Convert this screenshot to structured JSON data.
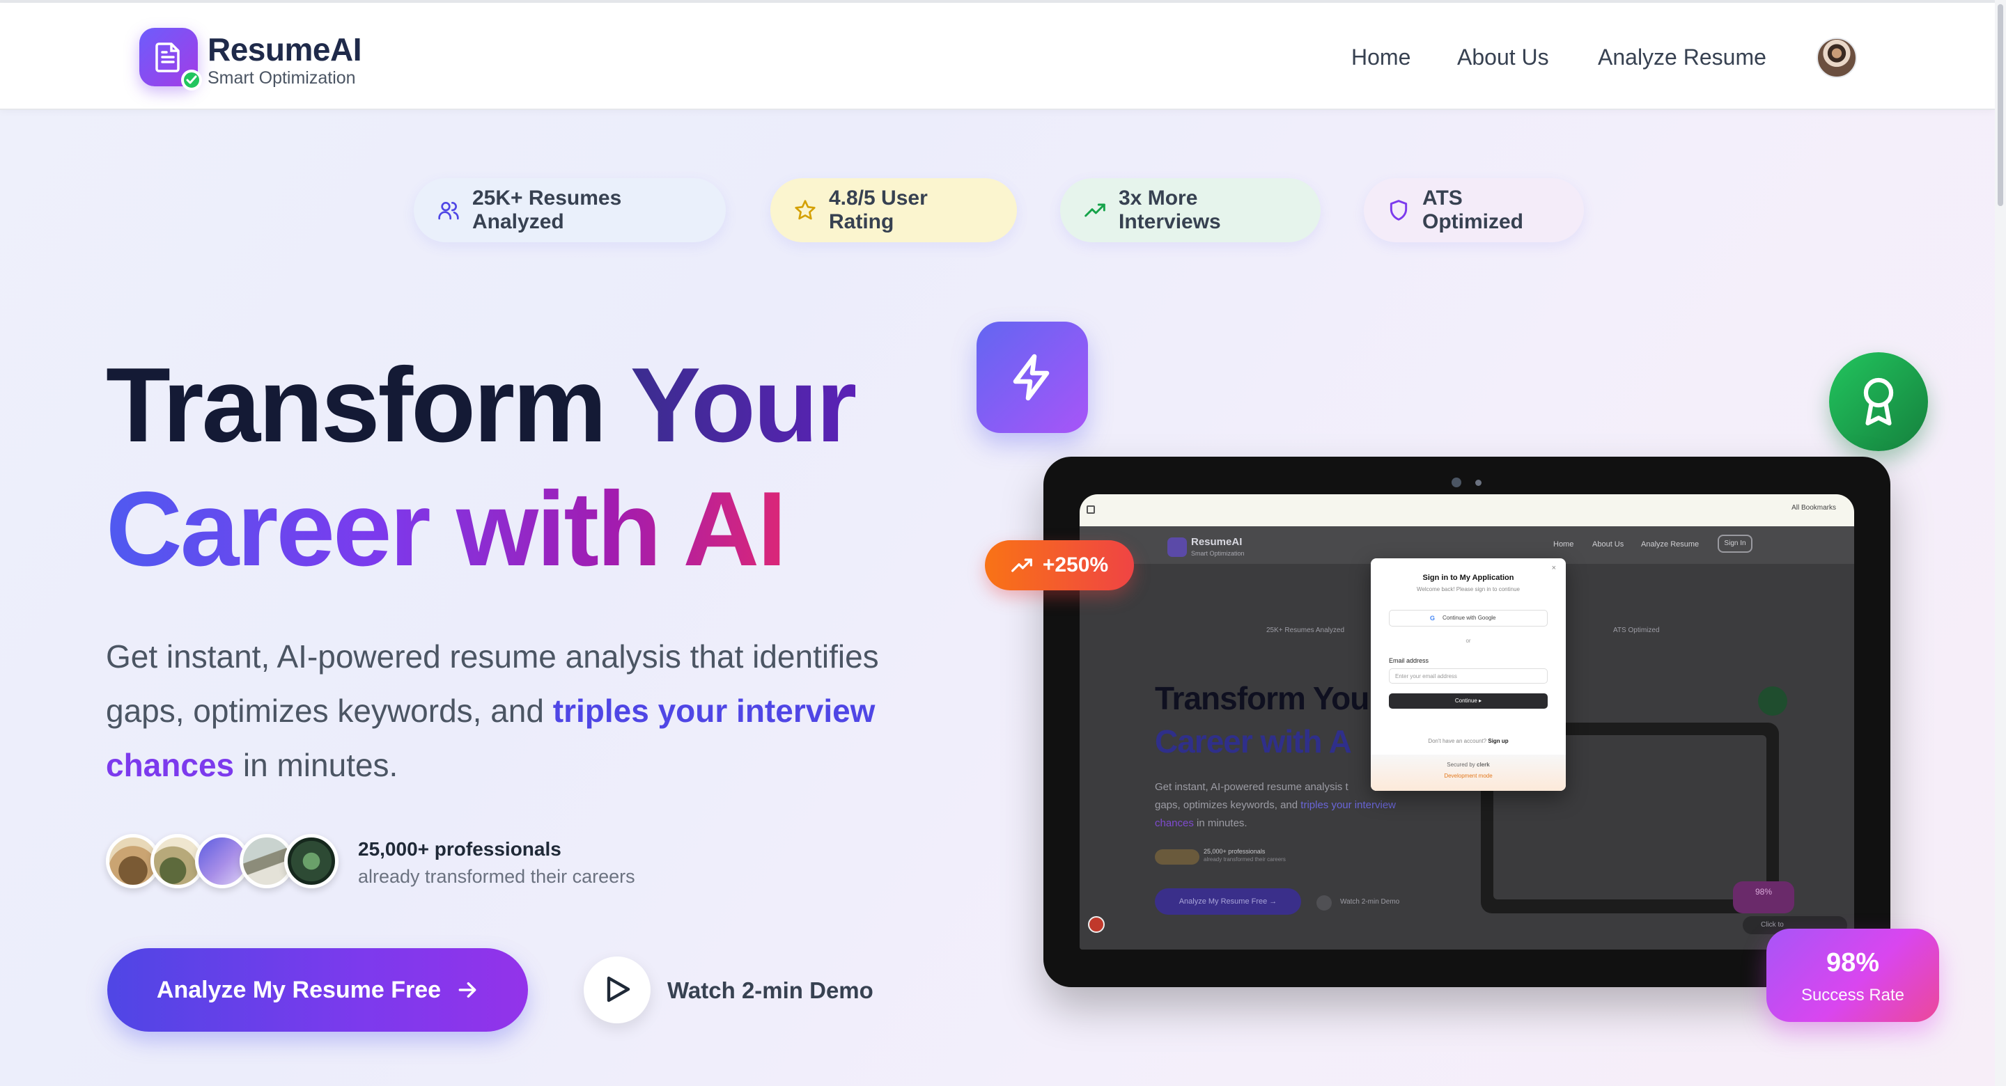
{
  "app": {
    "brand": "ResumeAI",
    "tagline": "Smart Optimization"
  },
  "nav": {
    "items": [
      "Home",
      "About Us",
      "Analyze Resume"
    ]
  },
  "pills": [
    {
      "label": "25K+ Resumes Analyzed",
      "icon": "users-icon",
      "bg": "#eaf0fb",
      "color": "#4f46e5"
    },
    {
      "label": "4.8/5 User Rating",
      "icon": "star-icon",
      "bg": "#fbf5cf",
      "color": "#d4a106"
    },
    {
      "label": "3x More Interviews",
      "icon": "trending-up-icon",
      "bg": "#e6f4ec",
      "color": "#16a34a"
    },
    {
      "label": "ATS Optimized",
      "icon": "shield-icon",
      "bg": "#f4ecf9",
      "color": "#7c3aed"
    }
  ],
  "hero": {
    "line1_a": "Transform ",
    "line1_b": "Your",
    "line2": "Career with AI",
    "desc_1": "Get instant, AI-powered resume analysis that identifies gaps, optimizes keywords, and ",
    "desc_hl_1": "triples your interview",
    "desc_hl_2": "chances",
    "desc_2": " in minutes."
  },
  "social": {
    "count": "25,000+ professionals",
    "sub": "already transformed their careers"
  },
  "cta": {
    "primary": "Analyze My Resume Free",
    "secondary": "Watch 2-min Demo"
  },
  "badges": {
    "growth": "+250%",
    "success_value": "98%",
    "success_label": "Success Rate"
  },
  "preview": {
    "bookmarks": "All Bookmarks",
    "brand": "ResumeAI",
    "brand_sub": "Smart Optimization",
    "nav": [
      "Home",
      "About Us",
      "Analyze Resume"
    ],
    "sign_in_btn": "Sign In",
    "pill_1": "25K+ Resumes Analyzed",
    "pill_4": "ATS Optimized",
    "headline_1": "Transform You",
    "headline_2": "Career with A",
    "desc_1": "Get instant, AI-powered resume analysis t",
    "desc_2": "gaps, optimizes keywords, and ",
    "desc_2_hl": "triples your interview",
    "desc_3": "chances",
    "desc_3_rest": " in minutes.",
    "social_1": "25,000+ professionals",
    "social_2": "already transformed their careers",
    "cta": "Analyze My Resume Free →",
    "demo": "Watch 2-min Demo",
    "mini_pct": "98%",
    "clerk_hint": "Click to",
    "modal": {
      "title": "Sign in to My Application",
      "subtitle": "Welcome back! Please sign in to continue",
      "google": "Continue with Google",
      "or": "or",
      "email_label": "Email address",
      "email_placeholder": "Enter your email address",
      "continue": "Continue ▸",
      "no_account": "Don't have an account?",
      "sign_up": "Sign up",
      "secured": "Secured by",
      "clerk": "clerk",
      "dev": "Development mode"
    }
  }
}
